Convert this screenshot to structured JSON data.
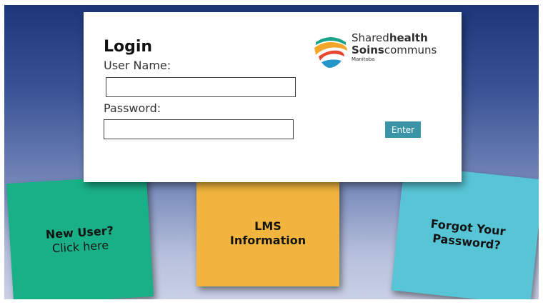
{
  "login": {
    "title": "Login",
    "username_label": "User Name:",
    "username_value": "",
    "password_label": "Password:",
    "password_value": "",
    "enter_label": "Enter"
  },
  "logo": {
    "line1_regular": "Shared",
    "line1_bold": "health",
    "line2_bold": "Soins",
    "line2_regular": "communs",
    "sub": "Manitoba"
  },
  "cards": {
    "new_user": {
      "title": "New User?",
      "subtitle": "Click here",
      "color": "#1ab087"
    },
    "lms": {
      "line1": "LMS",
      "line2": "Information",
      "color": "#f1b43e"
    },
    "forgot": {
      "line1": "Forgot Your",
      "line2": "Password?",
      "color": "#58c5d6"
    }
  },
  "colors": {
    "background_top": "#1c3678",
    "background_bottom": "#c9d0e6",
    "enter_button": "#3a95a8"
  }
}
